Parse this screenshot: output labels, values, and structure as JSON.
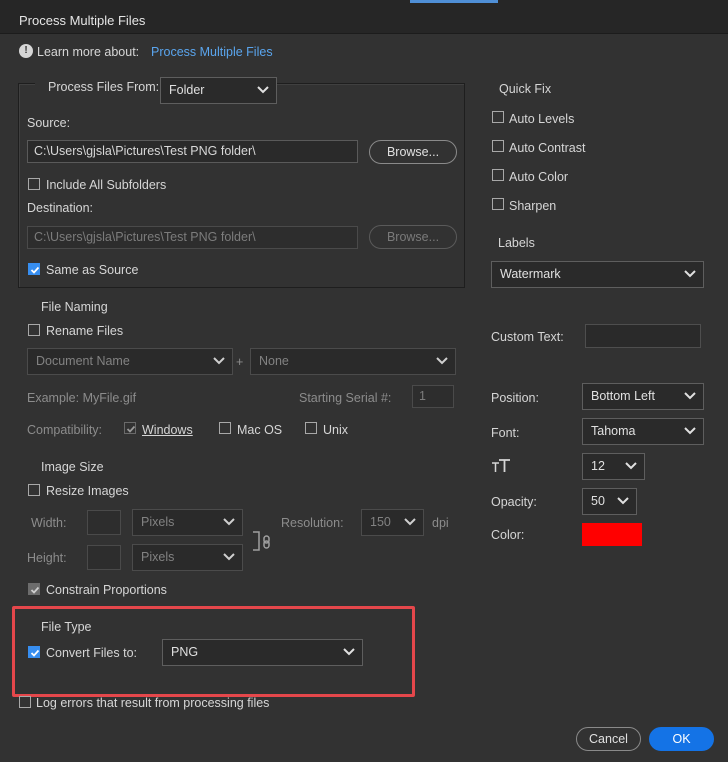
{
  "window": {
    "title": "Process Multiple Files"
  },
  "learn_more": {
    "label": "Learn more about:",
    "link": "Process Multiple Files"
  },
  "process_from": {
    "label": "Process Files From:",
    "value": "Folder",
    "source_label": "Source:",
    "source_path": "C:\\Users\\gjsla\\Pictures\\Test PNG folder\\",
    "browse_label": "Browse...",
    "include_subfolders_label": "Include All Subfolders",
    "destination_label": "Destination:",
    "destination_path": "C:\\Users\\gjsla\\Pictures\\Test PNG folder\\",
    "destination_browse_label": "Browse...",
    "same_as_source_label": "Same as Source"
  },
  "file_naming": {
    "heading": "File Naming",
    "rename_label": "Rename Files",
    "name_part1": "Document Name",
    "plus": "+",
    "name_part2": "None",
    "example": "Example: MyFile.gif",
    "serial_label": "Starting Serial #:",
    "serial_value": "1",
    "compat_label": "Compatibility:",
    "windows_label": "Windows",
    "macos_label": "Mac OS",
    "unix_label": "Unix"
  },
  "image_size": {
    "heading": "Image Size",
    "resize_label": "Resize Images",
    "width_label": "Width:",
    "height_label": "Height:",
    "width_unit": "Pixels",
    "height_unit": "Pixels",
    "resolution_label": "Resolution:",
    "resolution_value": "150",
    "dpi": "dpi",
    "constrain_label": "Constrain Proportions"
  },
  "file_type": {
    "heading": "File Type",
    "convert_label": "Convert Files to:",
    "format": "PNG"
  },
  "log_errors_label": "Log errors that result from processing files",
  "quick_fix": {
    "heading": "Quick Fix",
    "items": [
      "Auto Levels",
      "Auto Contrast",
      "Auto Color",
      "Sharpen"
    ]
  },
  "labels": {
    "heading": "Labels",
    "value": "Watermark",
    "custom_text_label": "Custom Text:",
    "position_label": "Position:",
    "position_value": "Bottom Left",
    "font_label": "Font:",
    "font_value": "Tahoma",
    "font_size_value": "12",
    "opacity_label": "Opacity:",
    "opacity_value": "50",
    "color_label": "Color:",
    "color_value": "#ff0000"
  },
  "buttons": {
    "cancel": "Cancel",
    "ok": "OK"
  },
  "colors": {
    "accent": "#1473e6",
    "highlight": "#e5474b"
  }
}
